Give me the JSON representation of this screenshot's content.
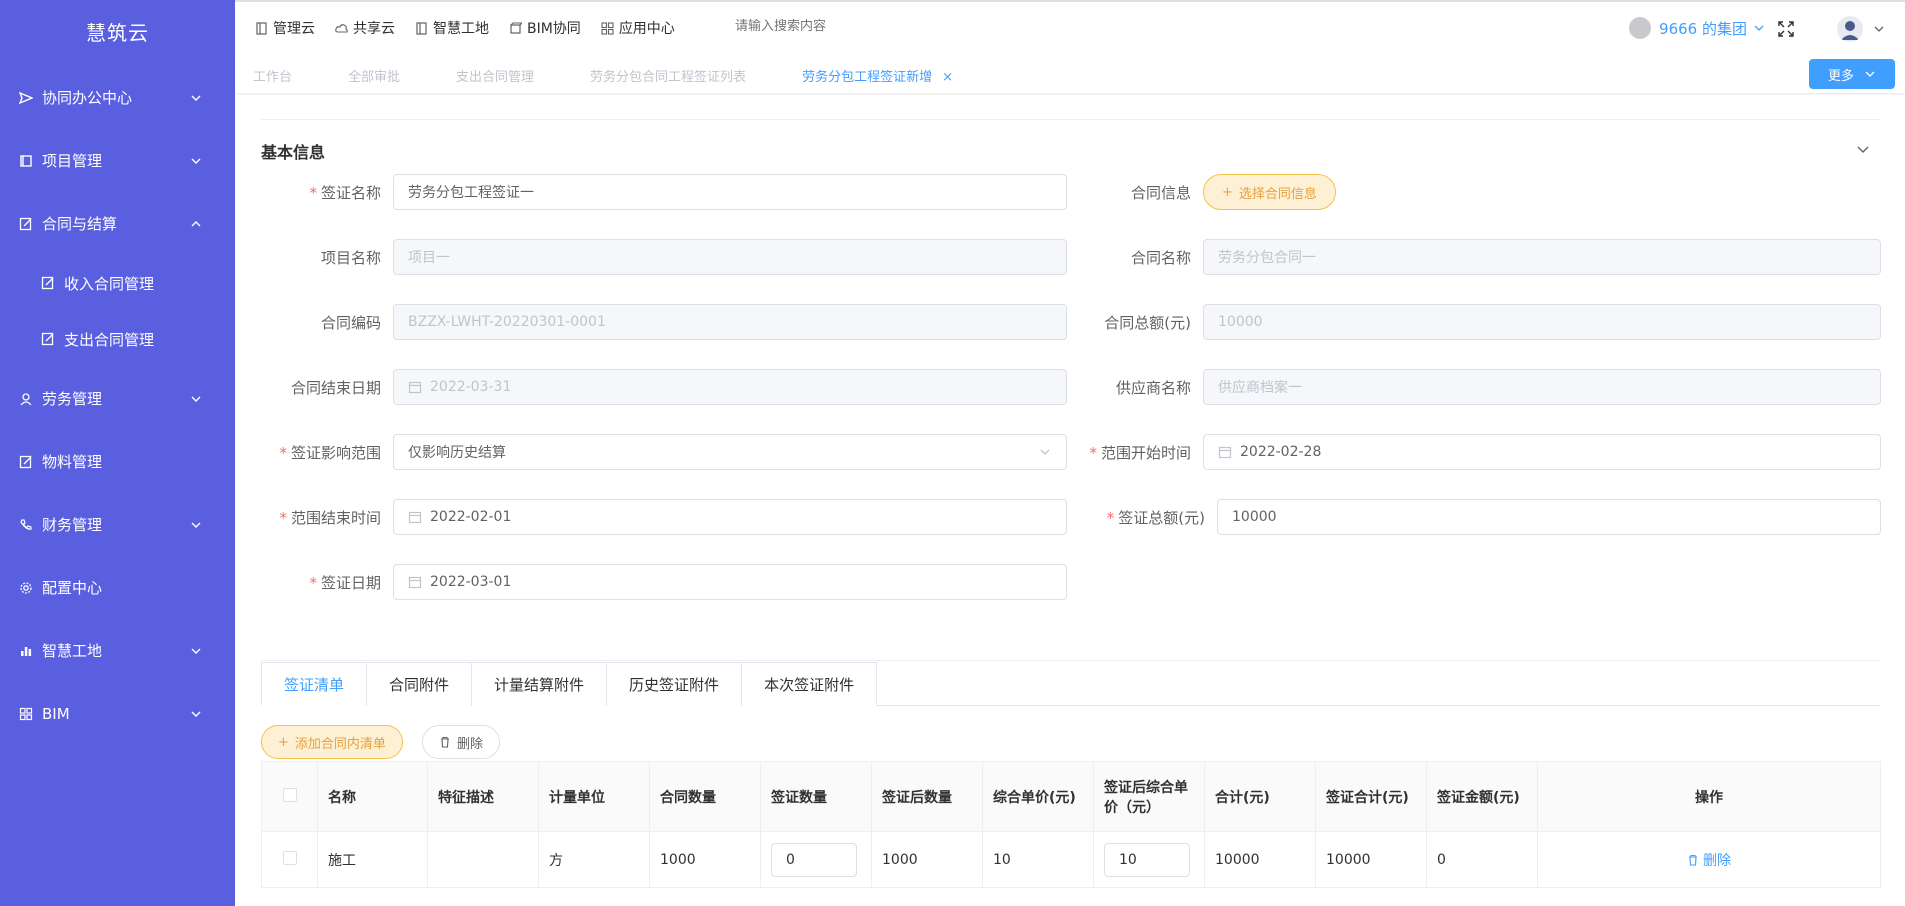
{
  "app": {
    "brand": "慧筑云"
  },
  "sidebar": {
    "items": [
      {
        "label": "协同办公中心",
        "icon": "send-icon",
        "expandable": true
      },
      {
        "label": "项目管理",
        "icon": "book-icon",
        "expandable": true
      },
      {
        "label": "合同与结算",
        "icon": "edit-doc-icon",
        "expandable": true,
        "expanded": true,
        "children": [
          {
            "label": "收入合同管理",
            "icon": "edit-doc-icon"
          },
          {
            "label": "支出合同管理",
            "icon": "edit-doc-icon"
          }
        ]
      },
      {
        "label": "劳务管理",
        "icon": "worker-icon",
        "expandable": true
      },
      {
        "label": "物料管理",
        "icon": "edit-doc-icon",
        "expandable": false
      },
      {
        "label": "财务管理",
        "icon": "phone-icon",
        "expandable": true
      },
      {
        "label": "配置中心",
        "icon": "gear-icon",
        "expandable": false
      },
      {
        "label": "智慧工地",
        "icon": "bar-chart-icon",
        "expandable": true
      },
      {
        "label": "BIM",
        "icon": "grid-icon",
        "expandable": true
      }
    ]
  },
  "topbar": {
    "nav": [
      {
        "label": "管理云",
        "icon": "doc-icon"
      },
      {
        "label": "共享云",
        "icon": "cloud-icon"
      },
      {
        "label": "智慧工地",
        "icon": "doc-icon"
      },
      {
        "label": "BIM协同",
        "icon": "cube-icon"
      },
      {
        "label": "应用中心",
        "icon": "grid-icon"
      }
    ],
    "search_placeholder": "请输入搜索内容",
    "org_name": "9666 的集团"
  },
  "tabs": {
    "items": [
      {
        "label": "工作台",
        "active": false
      },
      {
        "label": "全部审批",
        "active": false
      },
      {
        "label": "支出合同管理",
        "active": false
      },
      {
        "label": "劳务分包合同工程签证列表",
        "active": false
      },
      {
        "label": "劳务分包工程签证新增",
        "active": true,
        "closable": true
      }
    ],
    "more_label": "更多"
  },
  "form": {
    "section_title": "基本信息",
    "visa_name": {
      "label": "签证名称",
      "required": true,
      "value": "劳务分包工程签证一"
    },
    "contract_info": {
      "label": "合同信息",
      "button": "选择合同信息"
    },
    "project_name": {
      "label": "项目名称",
      "value": "项目一"
    },
    "contract_name": {
      "label": "合同名称",
      "value": "劳务分包合同一"
    },
    "contract_code": {
      "label": "合同编码",
      "value": "BZZX-LWHT-20220301-0001"
    },
    "contract_total": {
      "label": "合同总额(元)",
      "value": "10000"
    },
    "contract_end": {
      "label": "合同结束日期",
      "value": "2022-03-31"
    },
    "supplier": {
      "label": "供应商名称",
      "value": "供应商档案一"
    },
    "visa_scope": {
      "label": "签证影响范围",
      "required": true,
      "value": "仅影响历史结算"
    },
    "scope_start": {
      "label": "范围开始时间",
      "required": true,
      "value": "2022-02-28"
    },
    "scope_end": {
      "label": "范围结束时间",
      "required": true,
      "value": "2022-02-01"
    },
    "visa_total": {
      "label": "签证总额(元)",
      "required": true,
      "value": "10000"
    },
    "visa_date": {
      "label": "签证日期",
      "required": true,
      "value": "2022-03-01"
    }
  },
  "subtabs": {
    "items": [
      {
        "label": "签证清单",
        "active": true
      },
      {
        "label": "合同附件",
        "active": false
      },
      {
        "label": "计量结算附件",
        "active": false
      },
      {
        "label": "历史签证附件",
        "active": false
      },
      {
        "label": "本次签证附件",
        "active": false
      }
    ],
    "add_label": "添加合同内清单",
    "delete_label": "删除"
  },
  "table": {
    "headers": [
      "名称",
      "特征描述",
      "计量单位",
      "合同数量",
      "签证数量",
      "签证后数量",
      "综合单价(元)",
      "签证后综合单价（元）",
      "合计(元)",
      "签证合计(元)",
      "签证金额(元)",
      "操作"
    ],
    "rows": [
      {
        "name": "施工",
        "desc": "",
        "unit": "方",
        "contract_qty": "1000",
        "visa_qty": "0",
        "after_qty": "1000",
        "unit_price": "10",
        "after_price": "10",
        "total": "10000",
        "visa_total": "10000",
        "visa_amount": "0",
        "action": "删除"
      }
    ]
  },
  "colors": {
    "sidebar": "#5a5fe0",
    "primary": "#409eff",
    "warning": "#e6a23c",
    "danger": "#f56c6c"
  }
}
